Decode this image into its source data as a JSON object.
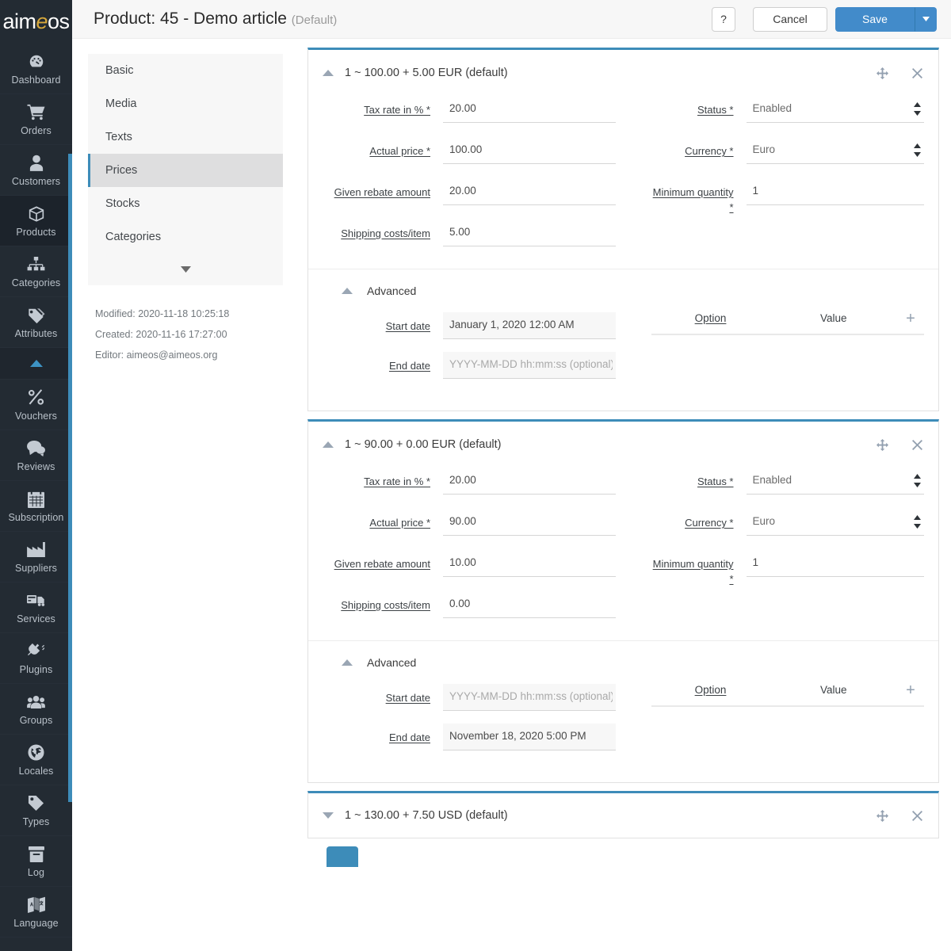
{
  "brand": {
    "name_part1": "aim",
    "name_accent": "e",
    "name_part2": "os"
  },
  "header": {
    "title": "Product: 45 - Demo article",
    "subtitle": "(Default)",
    "help_label": "?",
    "cancel_label": "Cancel",
    "save_label": "Save",
    "save_caret_icon": "caret-down-icon"
  },
  "sidebar": {
    "items": [
      {
        "label": "Dashboard",
        "icon": "dashboard-icon",
        "active": false
      },
      {
        "label": "Orders",
        "icon": "cart-icon",
        "active": false
      },
      {
        "label": "Customers",
        "icon": "user-icon",
        "active": false
      },
      {
        "label": "Products",
        "icon": "box-icon",
        "active": true
      },
      {
        "label": "Categories",
        "icon": "sitemap-icon",
        "active": false
      },
      {
        "label": "Attributes",
        "icon": "tags-icon",
        "active": false
      },
      {
        "label": "",
        "icon": "chevron-up-icon",
        "active": false,
        "toggle": true
      },
      {
        "label": "Vouchers",
        "icon": "percent-icon",
        "active": false
      },
      {
        "label": "Reviews",
        "icon": "comment-icon",
        "active": false
      },
      {
        "label": "Subscription",
        "icon": "calendar-icon",
        "active": false
      },
      {
        "label": "Suppliers",
        "icon": "factory-icon",
        "active": false
      },
      {
        "label": "Services",
        "icon": "truck-card-icon",
        "active": false
      },
      {
        "label": "Plugins",
        "icon": "plug-icon",
        "active": false
      },
      {
        "label": "Groups",
        "icon": "users-icon",
        "active": false
      },
      {
        "label": "Locales",
        "icon": "globe-icon",
        "active": false
      },
      {
        "label": "Types",
        "icon": "tag-icon",
        "active": false
      },
      {
        "label": "Log",
        "icon": "archive-icon",
        "active": false
      },
      {
        "label": "Language",
        "icon": "language-icon",
        "active": false
      }
    ]
  },
  "nav": {
    "items": [
      {
        "label": "Basic",
        "active": false
      },
      {
        "label": "Media",
        "active": false
      },
      {
        "label": "Texts",
        "active": false
      },
      {
        "label": "Prices",
        "active": true
      },
      {
        "label": "Stocks",
        "active": false
      },
      {
        "label": "Categories",
        "active": false
      }
    ],
    "more_icon": "chevron-down-icon"
  },
  "meta": {
    "modified": "Modified: 2020-11-18 10:25:18",
    "created": "Created: 2020-11-16 17:27:00",
    "editor": "Editor: aimeos@aimeos.org"
  },
  "labels": {
    "tax_rate": "Tax rate in % *",
    "actual_price": "Actual price *",
    "given_rebate": "Given rebate amount",
    "shipping_costs": "Shipping costs/item",
    "status": "Status *",
    "currency": "Currency *",
    "min_quantity": "Minimum quantity *",
    "advanced": "Advanced",
    "start_date": "Start date",
    "end_date": "End date",
    "option": "Option",
    "value": "Value",
    "add_icon": "plus-icon",
    "move_icon": "move-icon",
    "close_icon": "close-icon",
    "date_placeholder": "YYYY-MM-DD hh:mm:ss (optional)"
  },
  "panels": [
    {
      "title": "1 ~ 100.00 + 5.00 EUR (default)",
      "expanded": true,
      "chevron_icon": "chevron-up-icon",
      "tax_rate": "20.00",
      "actual_price": "100.00",
      "given_rebate": "20.00",
      "shipping_costs": "5.00",
      "status": "Enabled",
      "currency": "Euro",
      "min_quantity": "1",
      "advanced_expanded": true,
      "advanced_chevron_icon": "chevron-up-icon",
      "start_date": "January 1, 2020 12:00 AM",
      "end_date": "",
      "options": []
    },
    {
      "title": "1 ~ 90.00 + 0.00 EUR (default)",
      "expanded": true,
      "chevron_icon": "chevron-up-icon",
      "tax_rate": "20.00",
      "actual_price": "90.00",
      "given_rebate": "10.00",
      "shipping_costs": "0.00",
      "status": "Enabled",
      "currency": "Euro",
      "min_quantity": "1",
      "advanced_expanded": true,
      "advanced_chevron_icon": "chevron-up-icon",
      "start_date": "",
      "end_date": "November 18, 2020 5:00 PM",
      "options": []
    },
    {
      "title": "1 ~ 130.00 + 7.50 USD (default)",
      "expanded": false,
      "chevron_icon": "chevron-down-icon"
    }
  ],
  "footer": {
    "add_button_label": ""
  },
  "colors": {
    "accent": "#3d8cb9",
    "primary_button": "#428bca",
    "sidebar_bg": "#232b33",
    "logo_accent": "#d8a93c",
    "active_nav_bg": "#dededf"
  }
}
